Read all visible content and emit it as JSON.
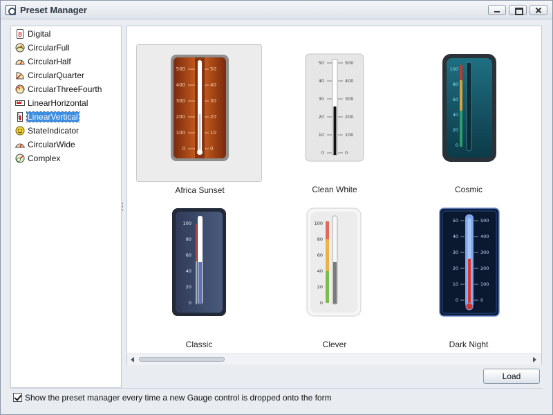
{
  "window": {
    "title": "Preset Manager"
  },
  "tree": {
    "items": [
      {
        "label": "Digital",
        "icon": "digital-gauge-icon"
      },
      {
        "label": "CircularFull",
        "icon": "circular-full-gauge-icon"
      },
      {
        "label": "CircularHalf",
        "icon": "circular-half-gauge-icon"
      },
      {
        "label": "CircularQuarter",
        "icon": "circular-quarter-gauge-icon"
      },
      {
        "label": "CircularThreeFourth",
        "icon": "circular-three-fourth-gauge-icon"
      },
      {
        "label": "LinearHorizontal",
        "icon": "linear-horizontal-gauge-icon"
      },
      {
        "label": "LinearVertical",
        "icon": "linear-vertical-gauge-icon",
        "selected": true
      },
      {
        "label": "StateIndicator",
        "icon": "state-indicator-icon"
      },
      {
        "label": "CircularWide",
        "icon": "circular-wide-gauge-icon"
      },
      {
        "label": "Complex",
        "icon": "complex-gauge-icon"
      }
    ]
  },
  "presets": [
    {
      "label": "Africa Sunset",
      "selected": true,
      "left_scale": [
        "500",
        "400",
        "300",
        "200",
        "100",
        "0"
      ],
      "right_scale": [
        "50",
        "40",
        "30",
        "20",
        "10",
        "0"
      ]
    },
    {
      "label": "Clean White",
      "left_scale": [
        "50",
        "40",
        "30",
        "20",
        "10",
        "0"
      ],
      "right_scale": [
        "500",
        "400",
        "300",
        "200",
        "100",
        "0"
      ]
    },
    {
      "label": "Cosmic",
      "left_scale": [
        "100",
        "80",
        "60",
        "40",
        "20",
        "0"
      ]
    },
    {
      "label": "Classic",
      "left_scale": [
        "100",
        "80",
        "60",
        "40",
        "20",
        "0"
      ]
    },
    {
      "label": "Clever",
      "left_scale": [
        "100",
        "80",
        "60",
        "40",
        "20",
        "0"
      ]
    },
    {
      "label": "Dark Night",
      "left_scale": [
        "50",
        "40",
        "30",
        "20",
        "10",
        "0"
      ],
      "right_scale": [
        "500",
        "400",
        "300",
        "200",
        "100",
        "0"
      ]
    }
  ],
  "buttons": {
    "load": "Load"
  },
  "footer": {
    "checkbox_checked": true,
    "checkbox_label": "Show the preset manager every time a new Gauge control is dropped onto the form"
  }
}
